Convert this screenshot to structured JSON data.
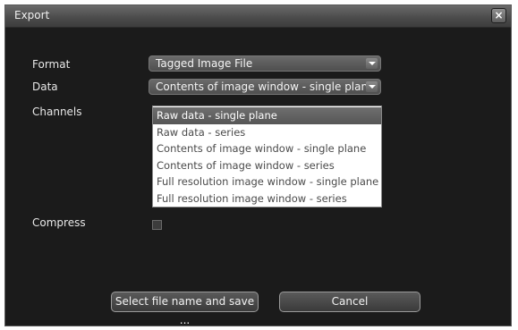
{
  "window": {
    "title": "Export",
    "close_glyph": "×"
  },
  "form": {
    "format_label": "Format",
    "format_value": "Tagged Image File",
    "data_label": "Data",
    "data_value": "Contents of image window - single plane",
    "channels_label": "Channels",
    "compress_label": "Compress",
    "compress_checked": false
  },
  "dropdown": {
    "items": [
      "Raw data - single plane",
      "Raw data - series",
      "Contents of image window - single plane",
      "Contents of image window - series",
      "Full resolution image window - single plane",
      "Full resolution image window - series"
    ],
    "highlighted_index": 0
  },
  "buttons": {
    "save_label": "Select file name and save ...",
    "cancel_label": "Cancel"
  },
  "icons": {
    "close": "close-icon",
    "dropdown_arrow": "chevron-down-icon"
  },
  "colors": {
    "background": "#1b1b1b",
    "titlebar": "#5a5a5a",
    "highlight": "#606060"
  }
}
